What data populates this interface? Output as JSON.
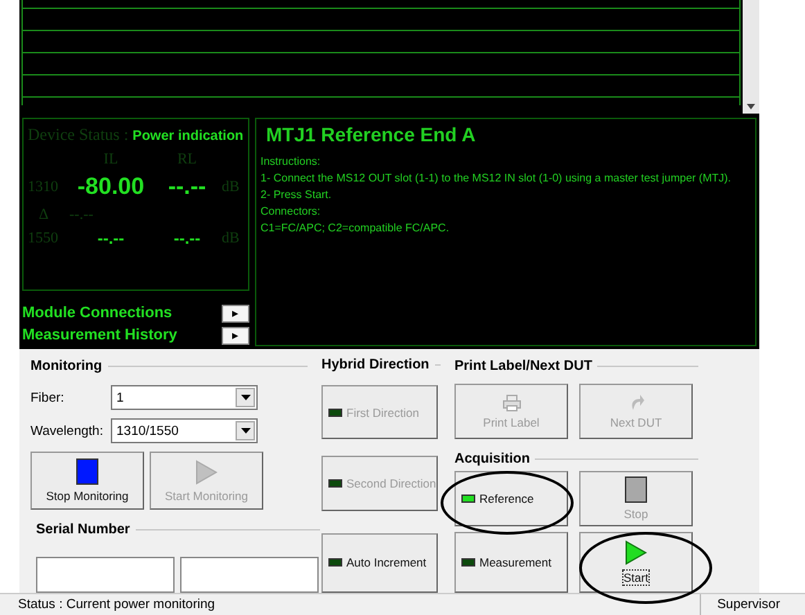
{
  "device_status": {
    "label": "Device Status :",
    "mode": "Power indication",
    "columns": [
      "IL",
      "RL"
    ],
    "rows": [
      {
        "kind": "reading",
        "wavelength": "1310",
        "il": "-80.00",
        "rl": "--.--",
        "unit": "dB"
      },
      {
        "kind": "delta",
        "wavelength": "Δ",
        "il": "--.--"
      },
      {
        "kind": "reading",
        "wavelength": "1550",
        "il": "--.--",
        "rl": "--.--",
        "unit": "dB"
      }
    ]
  },
  "links": [
    {
      "label": "Module Connections",
      "arrow": "▸"
    },
    {
      "label": "Measurement History",
      "arrow": "▸"
    }
  ],
  "instructions": {
    "title": "MTJ1 Reference End A",
    "lines": [
      "Instructions:",
      "1- Connect the MS12 OUT slot (1-1) to the MS12 IN slot (1-0) using a master test jumper (MTJ).",
      "2- Press Start.",
      "Connectors:",
      "C1=FC/APC; C2=compatible FC/APC."
    ]
  },
  "monitoring": {
    "title": "Monitoring",
    "fields": [
      {
        "label": "Fiber:",
        "value": "1"
      },
      {
        "label": "Wavelength:",
        "value": "1310/1550"
      }
    ],
    "buttons": [
      {
        "label": "Stop Monitoring",
        "disabled": false
      },
      {
        "label": "Start Monitoring",
        "disabled": true
      }
    ]
  },
  "serial_number": {
    "title": "Serial Number"
  },
  "hybrid_direction": {
    "title": "Hybrid Direction",
    "buttons": [
      {
        "label": "First Direction",
        "on": false,
        "disabled": true
      },
      {
        "label": "Second Direction",
        "on": false,
        "disabled": true
      },
      {
        "label": "Auto Increment",
        "on": false,
        "disabled": false
      }
    ]
  },
  "print_label": {
    "title": "Print Label/Next DUT",
    "buttons": [
      {
        "label": "Print Label",
        "disabled": true
      },
      {
        "label": "Next DUT",
        "disabled": true
      }
    ]
  },
  "acquisition": {
    "title": "Acquisition",
    "modes": [
      {
        "label": "Reference",
        "on": true
      },
      {
        "label": "Measurement",
        "on": false
      }
    ],
    "buttons": [
      {
        "label": "Stop",
        "disabled": true
      },
      {
        "label": "Start",
        "disabled": false
      }
    ]
  },
  "status_bar": {
    "status": "Status :  Current power monitoring",
    "user": "Supervisor"
  }
}
